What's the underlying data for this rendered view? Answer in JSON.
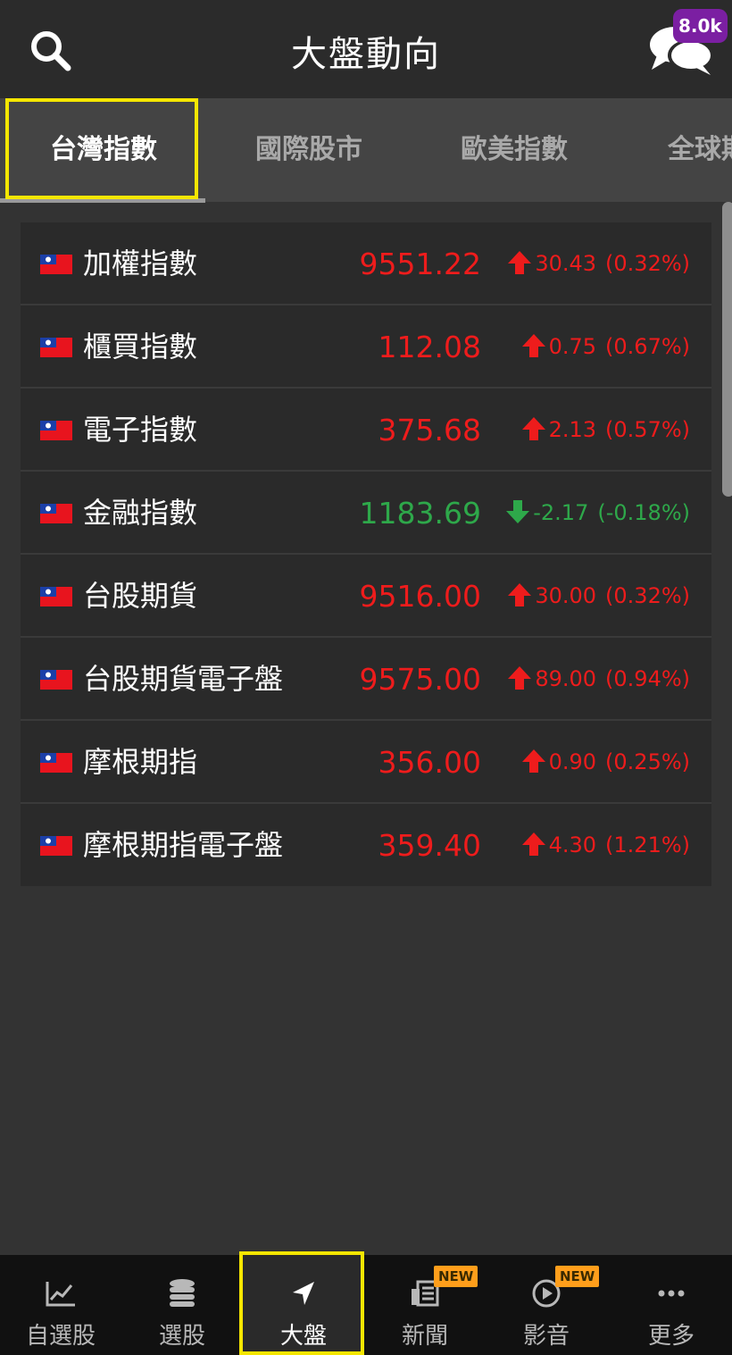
{
  "header": {
    "title": "大盤動向",
    "chat_badge": "8.0k",
    "search_icon": "search-icon",
    "chat_icon": "chat-bubbles-icon"
  },
  "tabs": [
    {
      "label": "台灣指數",
      "active": true
    },
    {
      "label": "國際股市",
      "active": false
    },
    {
      "label": "歐美指數",
      "active": false
    },
    {
      "label": "全球期",
      "active": false
    }
  ],
  "colors": {
    "up": "#ee1c1c",
    "down": "#2ea84a",
    "highlight": "#f5e600",
    "badge": "#7b1fa2",
    "new_badge": "#ff9e1b"
  },
  "rows": [
    {
      "name": "加權指數",
      "value": "9551.22",
      "change": "30.43",
      "pct": "(0.32%)",
      "dir": "up"
    },
    {
      "name": "櫃買指數",
      "value": "112.08",
      "change": "0.75",
      "pct": "(0.67%)",
      "dir": "up"
    },
    {
      "name": "電子指數",
      "value": "375.68",
      "change": "2.13",
      "pct": "(0.57%)",
      "dir": "up"
    },
    {
      "name": "金融指數",
      "value": "1183.69",
      "change": "-2.17",
      "pct": "(-0.18%)",
      "dir": "down"
    },
    {
      "name": "台股期貨",
      "value": "9516.00",
      "change": "30.00",
      "pct": "(0.32%)",
      "dir": "up"
    },
    {
      "name": "台股期貨電子盤",
      "value": "9575.00",
      "change": "89.00",
      "pct": "(0.94%)",
      "dir": "up"
    },
    {
      "name": "摩根期指",
      "value": "356.00",
      "change": "0.90",
      "pct": "(0.25%)",
      "dir": "up"
    },
    {
      "name": "摩根期指電子盤",
      "value": "359.40",
      "change": "4.30",
      "pct": "(1.21%)",
      "dir": "up"
    }
  ],
  "bottom_nav": [
    {
      "label": "自選股",
      "icon": "line-chart-icon",
      "active": false,
      "badge": ""
    },
    {
      "label": "選股",
      "icon": "coin-stack-icon",
      "active": false,
      "badge": ""
    },
    {
      "label": "大盤",
      "icon": "navigation-arrow-icon",
      "active": true,
      "badge": ""
    },
    {
      "label": "新聞",
      "icon": "newspaper-icon",
      "active": false,
      "badge": "NEW"
    },
    {
      "label": "影音",
      "icon": "play-circle-icon",
      "active": false,
      "badge": "NEW"
    },
    {
      "label": "更多",
      "icon": "more-dots-icon",
      "active": false,
      "badge": ""
    }
  ]
}
